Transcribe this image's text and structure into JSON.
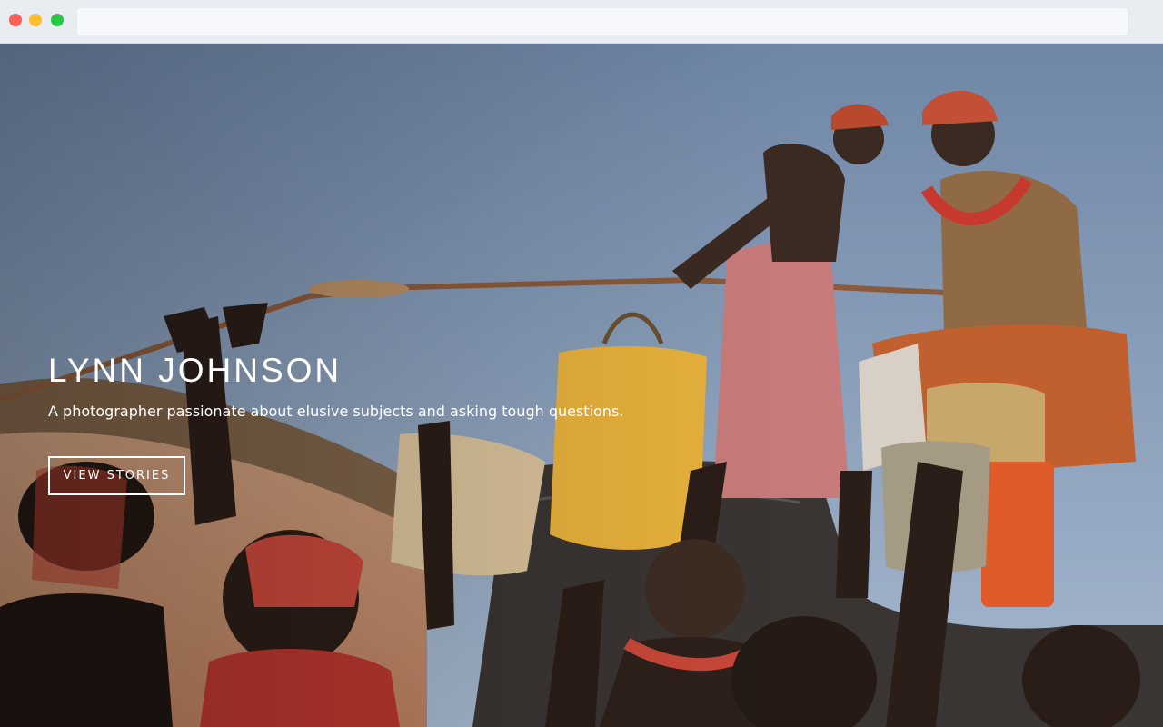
{
  "hero": {
    "title": "LYNN JOHNSON",
    "subtitle": "A photographer passionate about elusive subjects and asking tough questions.",
    "cta_label": "VIEW STORIES"
  },
  "colors": {
    "window_close": "#fe5f57",
    "window_minimize": "#febc2e",
    "window_zoom": "#28c840",
    "chrome_bg": "#e9ecf1",
    "sky_top": "#6f86a6",
    "sky_bottom": "#a6b8ce",
    "ground": "#c69272",
    "text": "#ffffff"
  }
}
